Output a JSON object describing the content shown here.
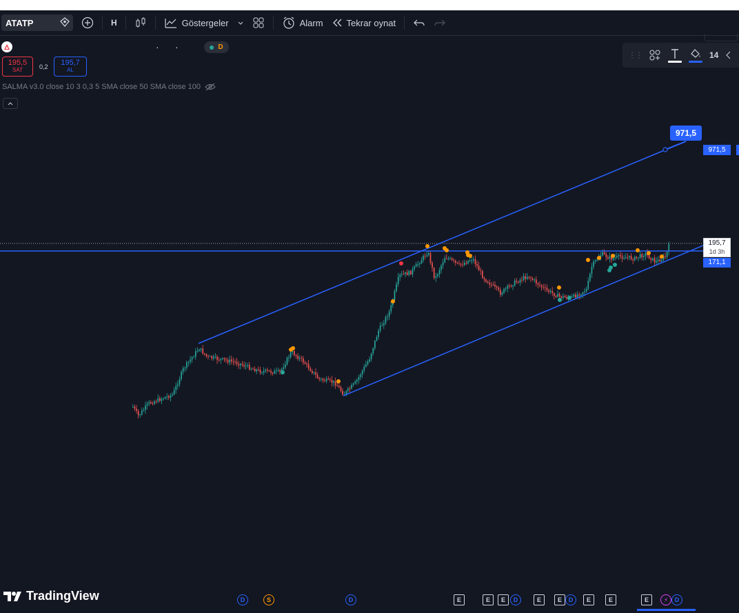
{
  "toolbar": {
    "symbol": "ATATP",
    "interval": "H",
    "indicators_label": "Göstergeler",
    "alarm_label": "Alarm",
    "replay_label": "Tekrar oynat"
  },
  "legend": {
    "dots": "·",
    "status_badge": "D",
    "sell": {
      "value": "195,5",
      "label": "SAT"
    },
    "spread": "0,2",
    "buy": {
      "value": "195,7",
      "label": "AL"
    },
    "indicator": "SALMA v3.0 close 10 3 0,3 5 SMA close 50 SMA close 100"
  },
  "drawing_toolbar": {
    "font_size": "14",
    "text_color": "#ffffff",
    "fill_color": "#2962ff"
  },
  "chart": {
    "target_callout": "971,5",
    "axis_labels": {
      "target": "971,5",
      "last_price": "195,7",
      "countdown": "1d 3h",
      "hline": "171,1"
    },
    "colors": {
      "up": "#26a69a",
      "down": "#ef5350",
      "trendline": "#2962ff",
      "signal_orange": "#ff9800",
      "background": "#131722"
    }
  },
  "brand": "TradingView",
  "events": [
    {
      "type": "D"
    },
    {
      "type": "S"
    },
    {
      "type": "D"
    },
    {
      "type": "E"
    },
    {
      "type": "E"
    },
    {
      "type": "E"
    },
    {
      "type": "D"
    },
    {
      "type": "E"
    },
    {
      "type": "E"
    },
    {
      "type": "D"
    },
    {
      "type": "E"
    },
    {
      "type": "E"
    },
    {
      "type": "E"
    },
    {
      "type": "⚡"
    },
    {
      "type": "D"
    }
  ]
}
